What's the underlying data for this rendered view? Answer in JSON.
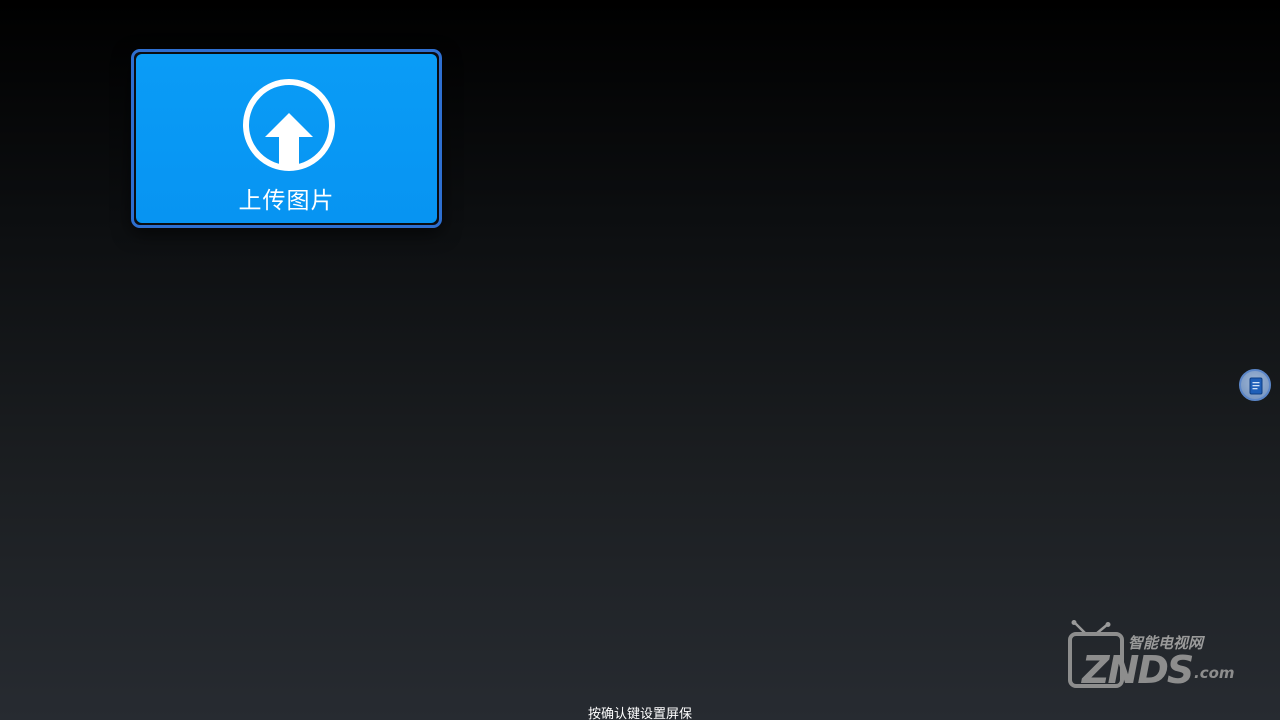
{
  "upload": {
    "label": "上传图片",
    "icon": "upload-arrow-circle-icon",
    "accent": "#0a9cf6",
    "focus_border": "#2e6fd0"
  },
  "side_button": {
    "icon": "document-icon"
  },
  "watermark": {
    "cn": "智能电视网",
    "main": "ZNDS",
    "suffix": ".com"
  },
  "hint": {
    "text": "按确认键设置屏保"
  }
}
